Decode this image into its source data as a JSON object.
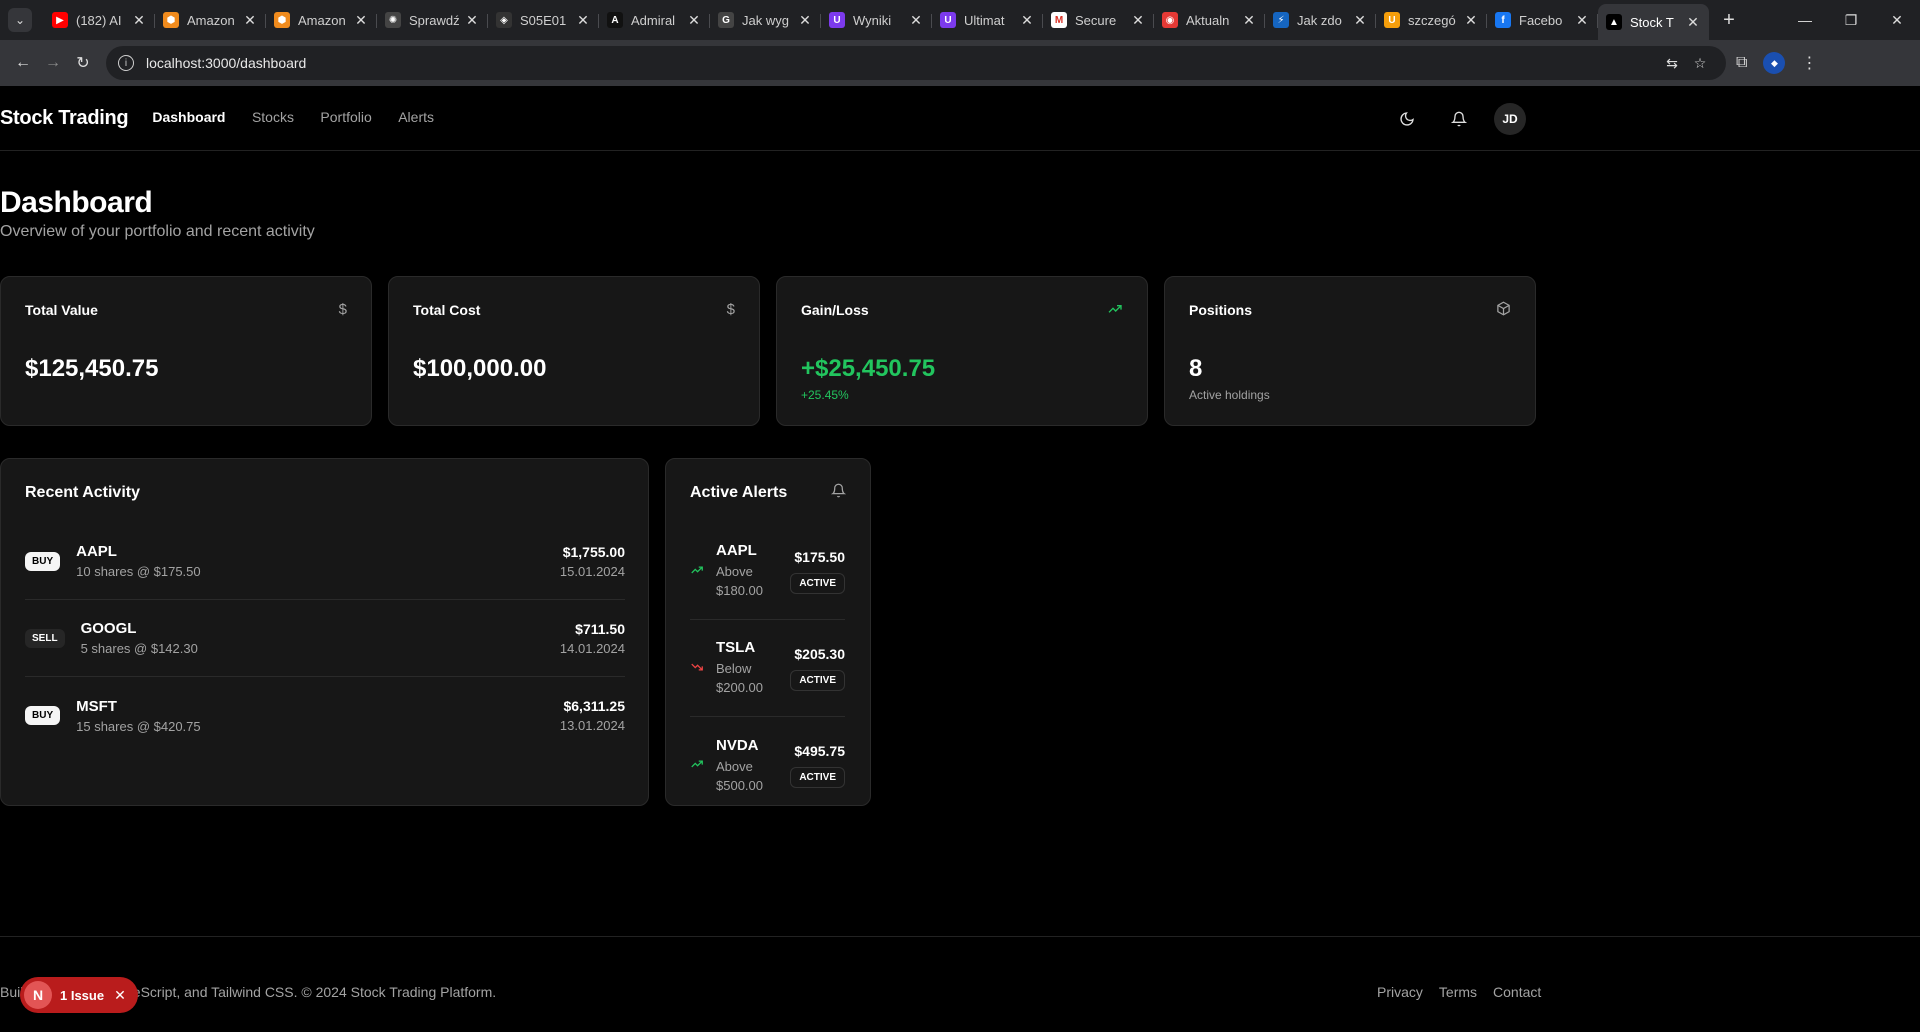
{
  "browser": {
    "tabs": [
      {
        "title": "(182) AI",
        "icon": "youtube-icon",
        "color": "#ff0000"
      },
      {
        "title": "Amazon",
        "icon": "aws-icon",
        "color": "#f08b1d"
      },
      {
        "title": "Amazon",
        "icon": "aws-icon",
        "color": "#f08b1d"
      },
      {
        "title": "Sprawdź",
        "icon": "openai-icon",
        "color": "#444444"
      },
      {
        "title": "S05E01",
        "icon": "shield-icon",
        "color": "#333333"
      },
      {
        "title": "Admiral",
        "icon": "admiral-icon",
        "color": "#111111"
      },
      {
        "title": "Jak wyg",
        "icon": "g-icon",
        "color": "#444444"
      },
      {
        "title": "Wyniki",
        "icon": "u-icon",
        "color": "#7c3aed"
      },
      {
        "title": "Ultimat",
        "icon": "u-icon",
        "color": "#7c3aed"
      },
      {
        "title": "Secure",
        "icon": "gmail-icon",
        "color": "#ffffff"
      },
      {
        "title": "Aktualn",
        "icon": "aktualn-icon",
        "color": "#e53935"
      },
      {
        "title": "Jak zdo",
        "icon": "bolt-icon",
        "color": "#1565c0"
      },
      {
        "title": "szczegó",
        "icon": "u-icon",
        "color": "#f59e0b"
      },
      {
        "title": "Facebo",
        "icon": "facebook-icon",
        "color": "#1877f2"
      },
      {
        "title": "Stock T",
        "icon": "nextjs-icon",
        "color": "#000000",
        "active": true
      }
    ],
    "url": "localhost:3000/dashboard"
  },
  "header": {
    "brand": "Stock Trading",
    "nav": [
      "Dashboard",
      "Stocks",
      "Portfolio",
      "Alerts"
    ],
    "avatar_initials": "JD"
  },
  "page": {
    "title": "Dashboard",
    "subtitle": "Overview of your portfolio and recent activity"
  },
  "stats": {
    "total_value": {
      "label": "Total Value",
      "value": "$125,450.75"
    },
    "total_cost": {
      "label": "Total Cost",
      "value": "$100,000.00"
    },
    "gain_loss": {
      "label": "Gain/Loss",
      "value": "+$25,450.75",
      "sub": "+25.45%"
    },
    "positions": {
      "label": "Positions",
      "value": "8",
      "sub": "Active holdings"
    }
  },
  "activity": {
    "title": "Recent Activity",
    "items": [
      {
        "type": "BUY",
        "symbol": "AAPL",
        "detail": "10 shares @ $175.50",
        "amount": "$1,755.00",
        "date": "15.01.2024"
      },
      {
        "type": "SELL",
        "symbol": "GOOGL",
        "detail": "5 shares @ $142.30",
        "amount": "$711.50",
        "date": "14.01.2024"
      },
      {
        "type": "BUY",
        "symbol": "MSFT",
        "detail": "15 shares @ $420.75",
        "amount": "$6,311.25",
        "date": "13.01.2024"
      }
    ]
  },
  "alerts": {
    "title": "Active Alerts",
    "items": [
      {
        "symbol": "AAPL",
        "dir": "Above",
        "target": "$180.00",
        "price": "$175.50",
        "status": "ACTIVE",
        "trend": "up"
      },
      {
        "symbol": "TSLA",
        "dir": "Below",
        "target": "$200.00",
        "price": "$205.30",
        "status": "ACTIVE",
        "trend": "down"
      },
      {
        "symbol": "NVDA",
        "dir": "Above",
        "target": "$500.00",
        "price": "$495.75",
        "status": "ACTIVE",
        "trend": "up"
      }
    ]
  },
  "footer": {
    "text": "Built with Next.js, TypeScript, and Tailwind CSS. © 2024 Stock Trading Platform.",
    "links": [
      "Privacy",
      "Terms",
      "Contact"
    ]
  },
  "dev_overlay": {
    "badge": "N",
    "label": "1 Issue"
  },
  "colors": {
    "positive": "#22c55e",
    "negative": "#ef4444",
    "issue": "#b91c1c"
  }
}
